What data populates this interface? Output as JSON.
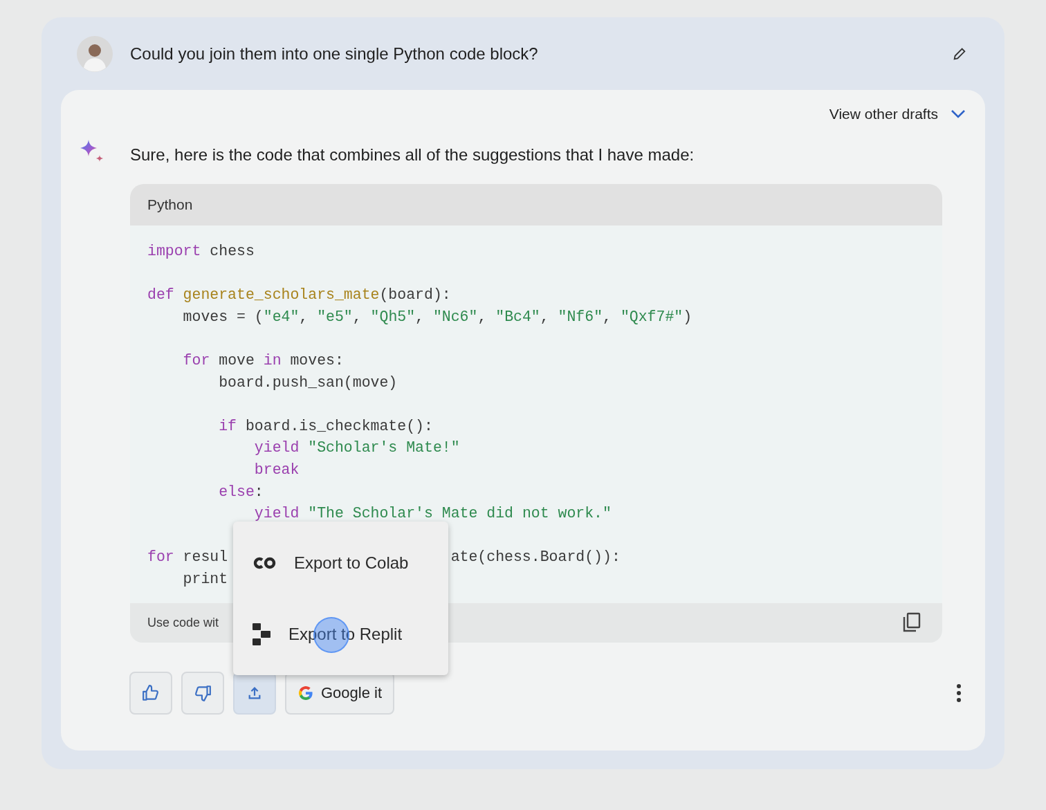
{
  "prompt": {
    "text": "Could you join them into one single Python code block?"
  },
  "drafts": {
    "label": "View other drafts",
    "expanded": false
  },
  "response": {
    "intro": "Sure, here is the code that combines all of the suggestions that I have made:",
    "code_block": {
      "language": "Python",
      "lines": [
        {
          "tokens": [
            {
              "kind": "keyword",
              "text": "import"
            },
            {
              "kind": "plain",
              "text": " chess"
            }
          ]
        },
        {
          "kind": "blank"
        },
        {
          "tokens": [
            {
              "kind": "keyword",
              "text": "def "
            },
            {
              "kind": "function",
              "text": "generate_scholars_mate"
            },
            {
              "kind": "plain",
              "text": "(board):"
            }
          ]
        },
        {
          "tokens": [
            {
              "kind": "plain",
              "text": "    moves = ("
            },
            {
              "kind": "string",
              "text": "\"e4\""
            },
            {
              "kind": "plain",
              "text": ", "
            },
            {
              "kind": "string",
              "text": "\"e5\""
            },
            {
              "kind": "plain",
              "text": ", "
            },
            {
              "kind": "string",
              "text": "\"Qh5\""
            },
            {
              "kind": "plain",
              "text": ", "
            },
            {
              "kind": "string",
              "text": "\"Nc6\""
            },
            {
              "kind": "plain",
              "text": ", "
            },
            {
              "kind": "string",
              "text": "\"Bc4\""
            },
            {
              "kind": "plain",
              "text": ", "
            },
            {
              "kind": "string",
              "text": "\"Nf6\""
            },
            {
              "kind": "plain",
              "text": ", "
            },
            {
              "kind": "string",
              "text": "\"Qxf7#\""
            },
            {
              "kind": "plain",
              "text": ")"
            }
          ]
        },
        {
          "kind": "blank"
        },
        {
          "tokens": [
            {
              "kind": "keyword",
              "text": "    for"
            },
            {
              "kind": "plain",
              "text": " move "
            },
            {
              "kind": "keyword",
              "text": "in"
            },
            {
              "kind": "plain",
              "text": " moves:"
            }
          ]
        },
        {
          "tokens": [
            {
              "kind": "plain",
              "text": "        board.push_san(move)"
            }
          ]
        },
        {
          "kind": "blank"
        },
        {
          "tokens": [
            {
              "kind": "keyword",
              "text": "        if"
            },
            {
              "kind": "plain",
              "text": " board.is_checkmate():"
            }
          ]
        },
        {
          "tokens": [
            {
              "kind": "keyword",
              "text": "            yield "
            },
            {
              "kind": "string",
              "text": "\"Scholar's Mate!\""
            }
          ]
        },
        {
          "tokens": [
            {
              "kind": "keyword",
              "text": "            break"
            }
          ]
        },
        {
          "tokens": [
            {
              "kind": "keyword",
              "text": "        else"
            },
            {
              "kind": "plain",
              "text": ":"
            }
          ]
        },
        {
          "tokens": [
            {
              "kind": "keyword",
              "text": "            yield "
            },
            {
              "kind": "string",
              "text": "\"The Scholar's Mate did not work.\""
            }
          ]
        },
        {
          "kind": "blank"
        },
        {
          "tokens": [
            {
              "kind": "keyword",
              "text": "for"
            },
            {
              "kind": "plain",
              "text": " resul"
            }
          ],
          "tail": [
            {
              "kind": "plain",
              "text": "ate(chess.Board()):"
            }
          ]
        },
        {
          "tokens": [
            {
              "kind": "plain",
              "text": "    print"
            }
          ]
        }
      ],
      "footer": "Use code wit"
    },
    "export_menu": [
      {
        "kind": "colab",
        "label": "Export to Colab"
      },
      {
        "kind": "replit",
        "label": "Export to Replit"
      }
    ],
    "actions": [
      {
        "kind": "thumbs_up",
        "selected": false
      },
      {
        "kind": "thumbs_down",
        "selected": false
      },
      {
        "kind": "share",
        "selected": true
      },
      {
        "kind": "google",
        "label": "Google it",
        "selected": false
      }
    ]
  }
}
